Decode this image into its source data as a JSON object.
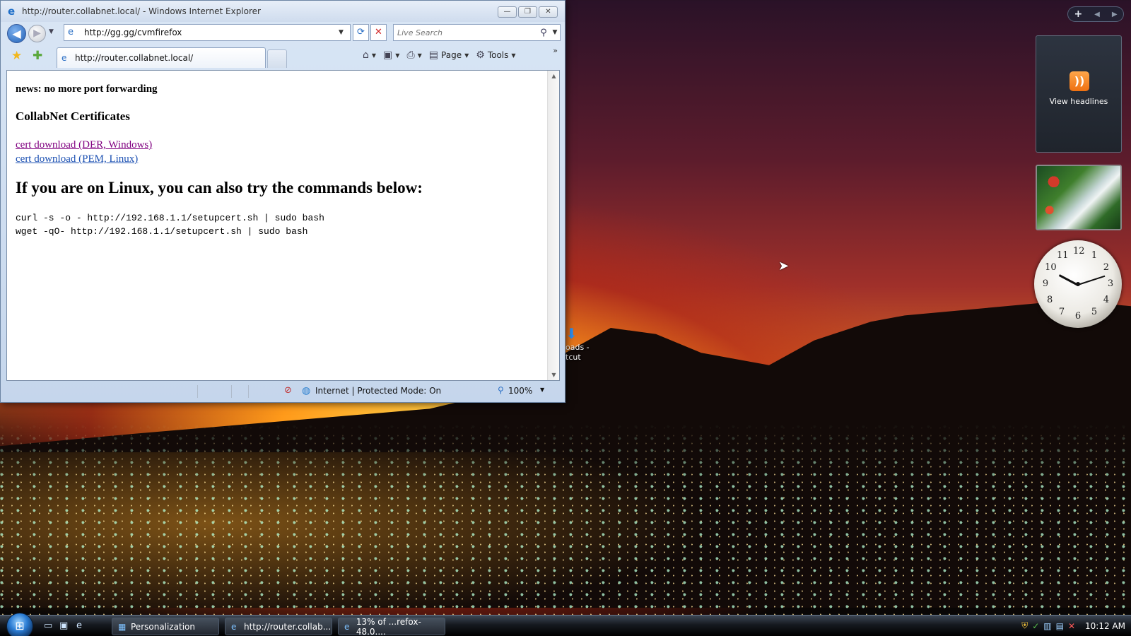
{
  "window": {
    "title": "http://router.collabnet.local/ - Windows Internet Explorer",
    "min_label": "—",
    "max_label": "❐",
    "close_label": "✕"
  },
  "nav": {
    "back_icon": "◀",
    "forward_icon": "▶",
    "address": "http://gg.gg/cvmfirefox",
    "search_placeholder": "Live Search"
  },
  "toolbar": {
    "tab_label": "http://router.collabnet.local/",
    "page_label": "Page",
    "tools_label": "Tools"
  },
  "page": {
    "news": "news: no more port forwarding",
    "cert_heading": "CollabNet Certificates",
    "link_der": "cert download (DER, Windows)",
    "link_pem": "cert download (PEM, Linux)",
    "big_heading": "If you are on Linux, you can also try the commands below:",
    "cmd_curl": "curl -s -o - http://192.168.1.1/setupcert.sh | sudo bash",
    "cmd_wget": "wget -qO- http://192.168.1.1/setupcert.sh | sudo bash"
  },
  "status": {
    "zone": "Internet | Protected Mode: On",
    "zoom": "100%"
  },
  "desktop": {
    "icon_label_1": "oads -",
    "icon_label_2": "tcut"
  },
  "gadgets": {
    "feeds_label": "View headlines",
    "clock_numbers": [
      "12",
      "1",
      "2",
      "3",
      "4",
      "5",
      "6",
      "7",
      "8",
      "9",
      "10",
      "11"
    ]
  },
  "taskbar": {
    "buttons": [
      {
        "label": "Personalization"
      },
      {
        "label": "http://router.collab..."
      },
      {
        "label": "13% of ...refox-48.0...."
      }
    ],
    "clock": "10:12 AM"
  },
  "icons": {
    "ie": "ie-icon",
    "back": "back-arrow-icon",
    "forward": "forward-arrow-icon",
    "refresh": "refresh-icon",
    "stop": "stop-icon",
    "search": "search-icon",
    "favorites": "favorites-star-icon",
    "add_favorite": "add-favorite-icon",
    "home": "home-icon",
    "feeds": "feeds-icon",
    "print": "print-icon",
    "page": "page-icon",
    "tools": "gear-icon",
    "rss": "rss-icon"
  },
  "colors": {
    "link_visited": "#800080",
    "link_normal": "#1a4fb2",
    "rss": "#ee7011"
  }
}
